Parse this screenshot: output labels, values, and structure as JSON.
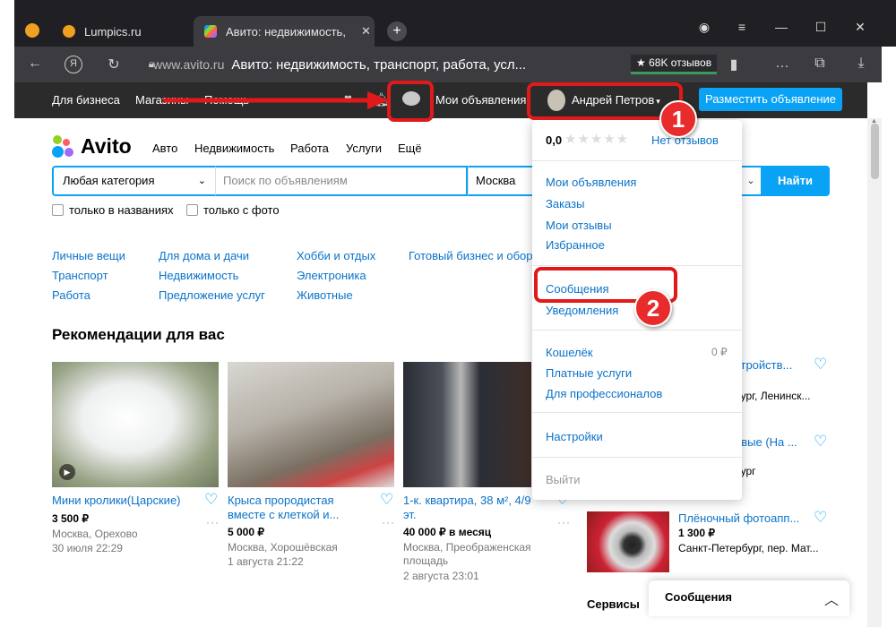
{
  "browser": {
    "tabs": [
      {
        "title": "Lumpics.ru",
        "active": false
      },
      {
        "title": "Авито: недвижимость,",
        "active": true
      }
    ],
    "new_tab_label": "+",
    "domain": "www.avito.ru",
    "page_title": "Авито: недвижимость, транспорт, работа, усл...",
    "reviews_badge": "★ 68K отзывов",
    "icons": [
      "back-icon",
      "yandex-icon",
      "reload-icon",
      "lock-icon",
      "bookmark-icon",
      "collections-icon",
      "mobile-icon",
      "download-icon",
      "menu-icon",
      "minimize-icon",
      "maximize-icon",
      "close-icon"
    ]
  },
  "sitebar": {
    "business": "Для бизнеса",
    "shops": "Магазины",
    "help": "Помощь",
    "my_ads": "Мои объявления",
    "user_name": "Андрей Петров",
    "post_ad": "Разместить объявление"
  },
  "nav": {
    "logo": "Avito",
    "links": [
      "Авто",
      "Недвижимость",
      "Работа",
      "Услуги",
      "Ещё"
    ]
  },
  "search": {
    "category": "Любая категория",
    "placeholder": "Поиск по объявлениям",
    "city": "Москва",
    "find": "Найти",
    "only_titles": "только в названиях",
    "only_photo": "только с фото"
  },
  "categories": [
    [
      "Личные вещи",
      "Транспорт",
      "Работа"
    ],
    [
      "Для дома и дачи",
      "Недвижимость",
      "Предложение услуг"
    ],
    [
      "Хобби и отдых",
      "Электроника",
      "Животные"
    ],
    [
      "Готовый бизнес и обору"
    ]
  ],
  "recommendations_title": "Рекомендации для вас",
  "cards": [
    {
      "title": "Мини кролики(Царские)",
      "price": "3 500 ₽",
      "location": "Москва, Орехово",
      "date": "30 июля 22:29"
    },
    {
      "title": "Крыса прородистая вместе с клеткой и...",
      "price": "5 000 ₽",
      "location": "Москва, Хорошёвская",
      "date": "1 августа 21:22"
    },
    {
      "title": "1-к. квартира, 38 м², 4/9 эт.",
      "price": "40 000 ₽ в месяц",
      "location": "Москва, Преображенская площадь",
      "date": "2 августа 23:01"
    }
  ],
  "dropdown": {
    "rating": "0,0",
    "no_reviews": "Нет отзывов",
    "group1": [
      "Мои объявления",
      "Заказы",
      "Мои отзывы",
      "Избранное"
    ],
    "messages": "Сообщения",
    "notifications": "Уведомления",
    "wallet": "Кошелёк",
    "wallet_value": "0 ₽",
    "paid": "Платные услуги",
    "pro": "Для профессионалов",
    "settings": "Настройки",
    "logout": "Выйти"
  },
  "right_column": {
    "item1_title": "стройств...",
    "item1_loc": "бург, Ленинск...",
    "item2_title": "овые (На ...",
    "item2_loc": "бург",
    "item3_title": "Плёночный фотоапп...",
    "item3_price": "1 300 ₽",
    "item3_loc": "Санкт-Петербург, пер. Мат...",
    "services": "Сервисы"
  },
  "messages_panel": "Сообщения",
  "annotations": {
    "badge1": "1",
    "badge2": "2"
  },
  "colors": {
    "accent": "#0aa2f5",
    "link": "#0a73c9",
    "annotation": "#e01a1a"
  }
}
